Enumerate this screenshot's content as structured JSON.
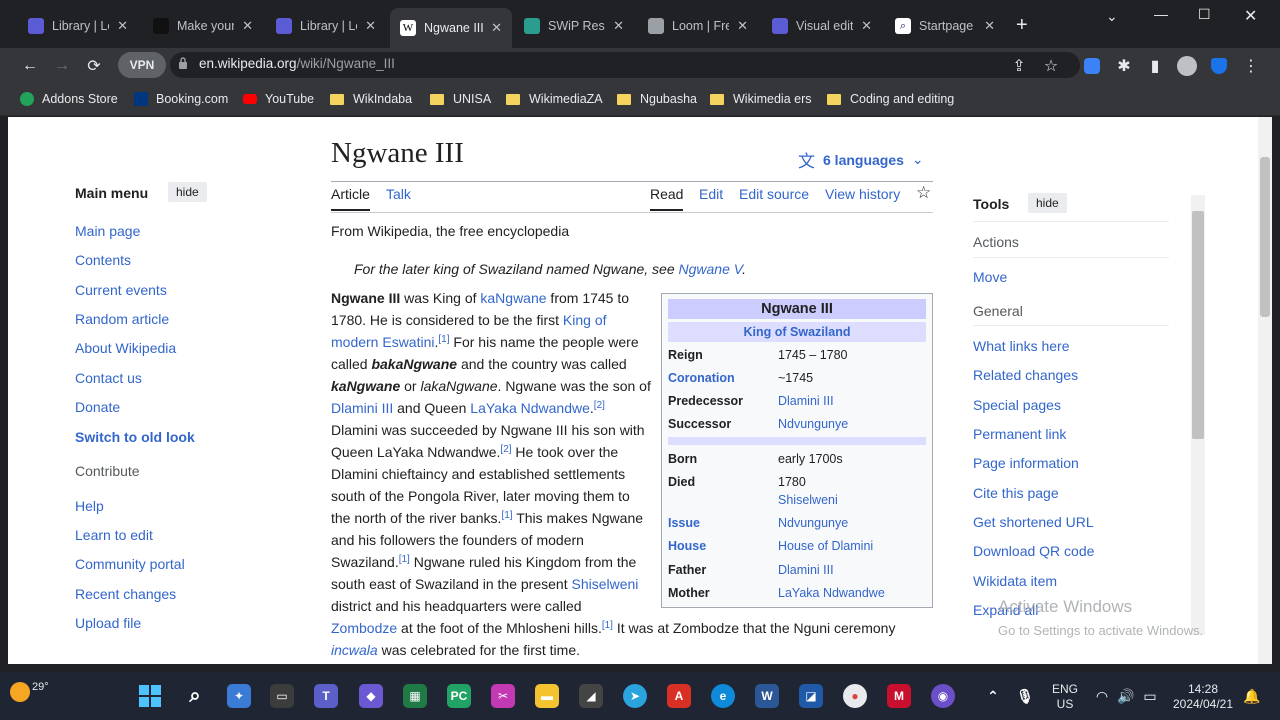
{
  "browser": {
    "tabs": [
      {
        "label": "Library | Le",
        "icon": "gear-icon",
        "color": "#5b5bd6",
        "active": false
      },
      {
        "label": "Make your",
        "icon": "github-icon",
        "color": "#111111",
        "active": false
      },
      {
        "label": "Library | Le",
        "icon": "gear-icon",
        "color": "#5b5bd6",
        "active": false
      },
      {
        "label": "Ngwane III",
        "icon": "wikipedia-icon",
        "color": "#ffffff",
        "active": true
      },
      {
        "label": "SWiP Rese",
        "icon": "swip-icon",
        "color": "#2a9d8f",
        "active": false
      },
      {
        "label": "Loom | Fre",
        "icon": "globe-icon",
        "color": "#9aa0a6",
        "active": false
      },
      {
        "label": "Visual edit",
        "icon": "gear-icon",
        "color": "#5b5bd6",
        "active": false
      },
      {
        "label": "Startpage",
        "icon": "search-icon",
        "color": "#ffffff",
        "active": false
      }
    ],
    "vpn_label": "VPN",
    "url_domain": "en.wikipedia.org",
    "url_path": "/wiki/Ngwane_III",
    "bookmarks": [
      {
        "label": "Addons Store",
        "type": "addons"
      },
      {
        "label": "Booking.com",
        "type": "booking"
      },
      {
        "label": "YouTube",
        "type": "youtube"
      },
      {
        "label": "WikIndaba",
        "type": "folder"
      },
      {
        "label": "UNISA",
        "type": "folder"
      },
      {
        "label": "WikimediaZA",
        "type": "folder"
      },
      {
        "label": "Ngubasha",
        "type": "folder"
      },
      {
        "label": "Wikimedia ers",
        "type": "folder"
      },
      {
        "label": "Coding and editing",
        "type": "folder"
      }
    ]
  },
  "wiki": {
    "main_menu": {
      "heading": "Main menu",
      "hide": "hide",
      "links": [
        "Main page",
        "Contents",
        "Current events",
        "Random article",
        "About Wikipedia",
        "Contact us",
        "Donate"
      ],
      "switch_look": "Switch to old look",
      "contribute_heading": "Contribute",
      "contribute_links": [
        "Help",
        "Learn to edit",
        "Community portal",
        "Recent changes",
        "Upload file"
      ]
    },
    "title": "Ngwane III",
    "languages": "6 languages",
    "page_tabs": {
      "article": "Article",
      "talk": "Talk",
      "read": "Read",
      "edit": "Edit",
      "edit_source": "Edit source",
      "view_history": "View history"
    },
    "tagline": "From Wikipedia, the free encyclopedia",
    "hatnote_text": "For the later king of Swaziland named Ngwane, see ",
    "hatnote_link": "Ngwane V",
    "hatnote_end": ".",
    "infobox": {
      "title": "Ngwane III",
      "subtitle": "King of Swaziland",
      "rows_top": [
        {
          "label": "Reign",
          "value": "1745 – 1780",
          "label_link": false,
          "value_link": false
        },
        {
          "label": "Coronation",
          "value": "~1745",
          "label_link": true,
          "value_link": false
        },
        {
          "label": "Predecessor",
          "value": "Dlamini III",
          "label_link": false,
          "value_link": true
        },
        {
          "label": "Successor",
          "value": "Ndvungunye",
          "label_link": false,
          "value_link": true
        }
      ],
      "rows_bottom": [
        {
          "label": "Born",
          "value": "early 1700s",
          "label_link": false,
          "value_link": false
        },
        {
          "label": "Died",
          "value": "1780",
          "value2": "Shiselweni",
          "label_link": false,
          "value_link": false
        },
        {
          "label": "Issue",
          "value": "Ndvungunye",
          "label_link": true,
          "value_link": true
        },
        {
          "label": "House",
          "value": "House of Dlamini",
          "label_link": true,
          "value_link": true
        },
        {
          "label": "Father",
          "value": "Dlamini III",
          "label_link": false,
          "value_link": true
        },
        {
          "label": "Mother",
          "value": "LaYaka Ndwandwe",
          "label_link": false,
          "value_link": true
        }
      ]
    },
    "tools": {
      "heading": "Tools",
      "hide": "hide",
      "actions_heading": "Actions",
      "move": "Move",
      "general_heading": "General",
      "links": [
        "What links here",
        "Related changes",
        "Special pages",
        "Permanent link",
        "Page information",
        "Cite this page",
        "Get shortened URL",
        "Download QR code",
        "Wikidata item",
        "Expand all"
      ]
    },
    "watermark": {
      "line1": "Activate Windows",
      "line2": "Go to Settings to activate Windows."
    }
  },
  "taskbar": {
    "temperature": "29°",
    "lang_line1": "ENG",
    "lang_line2": "US",
    "time": "14:28",
    "date": "2024/04/21"
  }
}
